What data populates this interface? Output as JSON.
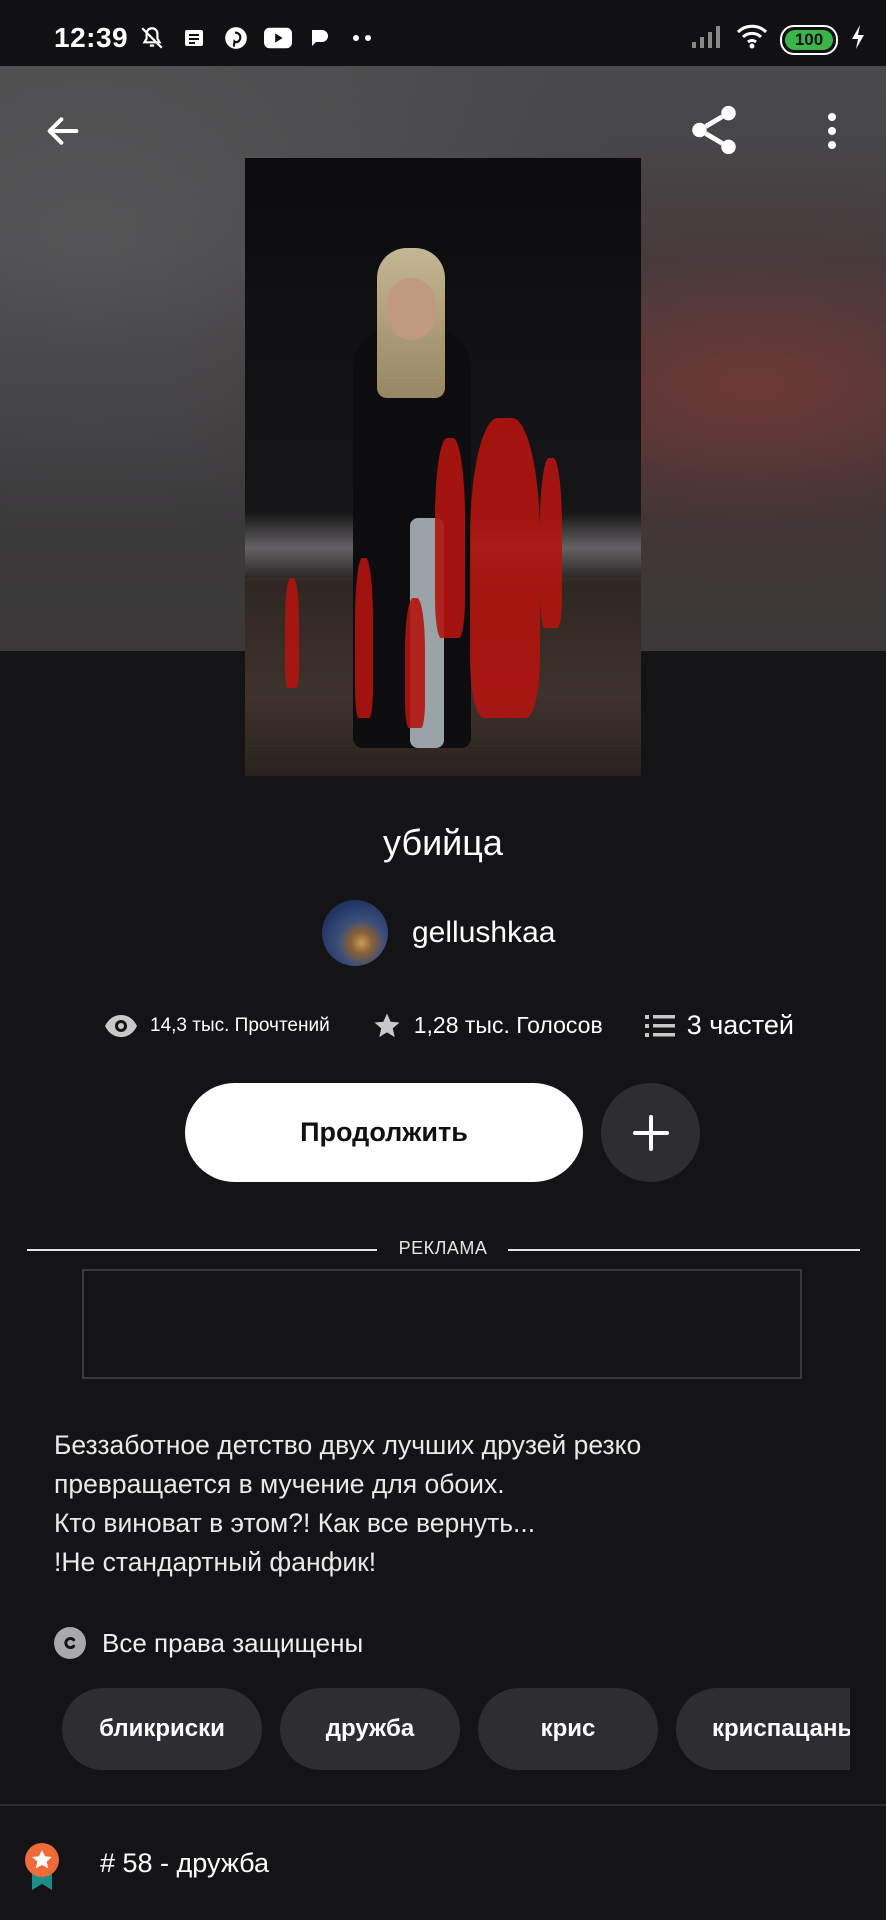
{
  "status_bar": {
    "time": "12:39",
    "battery": "100",
    "icons_left": [
      "mute-bell-icon",
      "news-icon",
      "pinterest-icon",
      "youtube-icon",
      "app-icon",
      "more-dots-icon"
    ],
    "icons_right": [
      "signal-icon",
      "wifi-icon",
      "battery-icon",
      "charging-icon"
    ]
  },
  "header": {
    "back_icon": "arrow-left-icon",
    "share_icon": "share-icon",
    "more_icon": "vertical-dots-icon"
  },
  "story": {
    "title": "убийца",
    "author": "gellushkaa",
    "stats": {
      "reads": "14,3 тыс. Прочтений",
      "votes": "1,28 тыс. Голосов",
      "parts": "3 частей"
    },
    "continue_label": "Продолжить",
    "ad_label": "РЕКЛАМА",
    "description": [
      "Беззаботное детство двух лучших друзей резко",
      "превращается в мучение для обоих.",
      "Кто виноват в этом?! Как все вернуть...",
      "!Не стандартный фанфик!"
    ],
    "copyright": "Все права защищены",
    "tags": [
      "бликриски",
      "дружба",
      "крис",
      "криспацаны"
    ],
    "rank": "# 58 - дружба"
  },
  "colors": {
    "background": "#141316",
    "button_dark": "#2e2d31",
    "rank_badge": "#f06a3a",
    "battery_green": "#3ab54a"
  }
}
